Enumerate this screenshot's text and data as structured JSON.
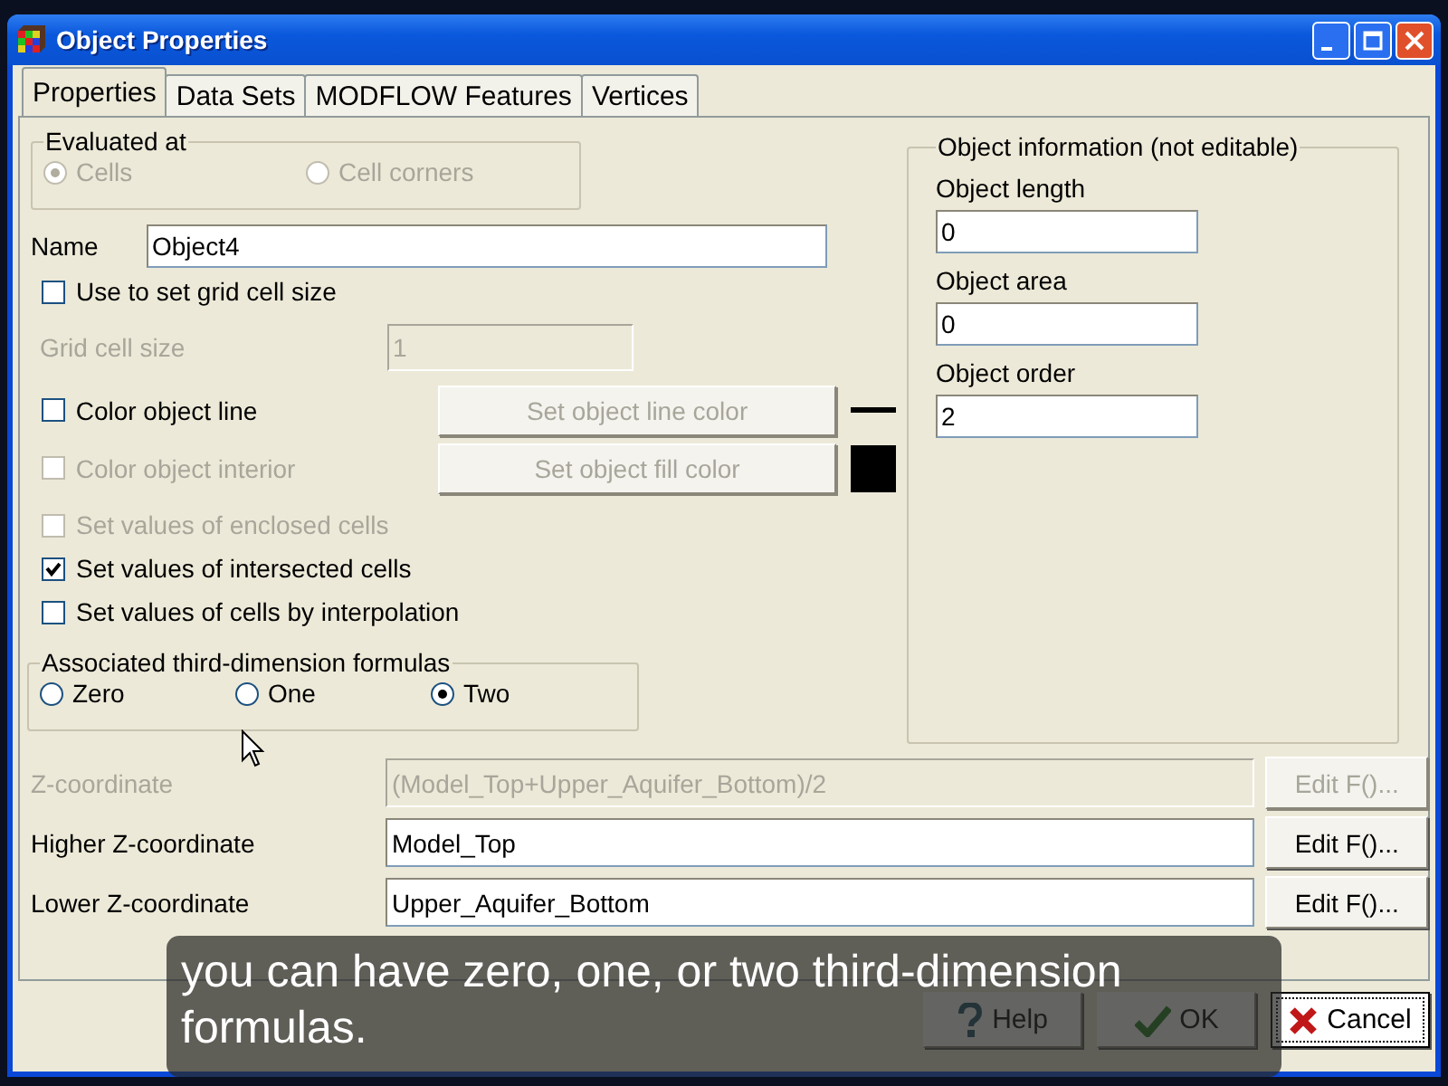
{
  "window": {
    "title": "Object Properties"
  },
  "tabs": [
    {
      "label": "Properties",
      "selected": true
    },
    {
      "label": "Data Sets",
      "selected": false
    },
    {
      "label": "MODFLOW Features",
      "selected": false
    },
    {
      "label": "Vertices",
      "selected": false
    }
  ],
  "evaluated_at": {
    "label": "Evaluated at",
    "disabled": true,
    "options": [
      {
        "label": "Cells",
        "selected": true
      },
      {
        "label": "Cell corners",
        "selected": false
      }
    ]
  },
  "name": {
    "label": "Name",
    "value": "Object4"
  },
  "rows": [
    {
      "kind": "checkbox",
      "label": "Use to set grid cell size",
      "checked": false,
      "disabled": false
    },
    {
      "kind": "field",
      "label": "Grid cell size",
      "value": "1",
      "disabled": true
    },
    {
      "kind": "color",
      "label": "Color object line",
      "checked": false,
      "disabled": false,
      "button": "Set object line color",
      "button_disabled": true,
      "swatch": {
        "kind": "line"
      }
    },
    {
      "kind": "color",
      "label": "Color object interior",
      "checked": false,
      "disabled": true,
      "button": "Set object fill color",
      "button_disabled": true,
      "swatch": {
        "kind": "fill"
      }
    },
    {
      "kind": "checkbox",
      "label": "Set values of enclosed cells",
      "checked": false,
      "disabled": true
    },
    {
      "kind": "checkbox",
      "label": "Set values of intersected cells",
      "checked": true,
      "disabled": false
    },
    {
      "kind": "checkbox",
      "label": "Set values of cells by interpolation",
      "checked": false,
      "disabled": false
    }
  ],
  "formulas": {
    "label": "Associated third-dimension formulas",
    "options": [
      {
        "label": "Zero",
        "selected": false
      },
      {
        "label": "One",
        "selected": false
      },
      {
        "label": "Two",
        "selected": true
      }
    ]
  },
  "object_info": {
    "label": "Object information (not editable)",
    "fields": [
      {
        "label": "Object length",
        "value": "0"
      },
      {
        "label": "Object area",
        "value": "0"
      },
      {
        "label": "Object order",
        "value": "2"
      }
    ]
  },
  "z_rows": [
    {
      "label": "Z-coordinate",
      "value": "(Model_Top+Upper_Aquifer_Bottom)/2",
      "disabled": true,
      "button": "Edit F()..."
    },
    {
      "label": "Higher Z-coordinate",
      "value": "Model_Top",
      "disabled": false,
      "button": "Edit F()..."
    },
    {
      "label": "Lower Z-coordinate",
      "value": "Upper_Aquifer_Bottom",
      "disabled": false,
      "button": "Edit F()..."
    }
  ],
  "buttons": [
    {
      "kind": "help",
      "label": "Help",
      "focused": false
    },
    {
      "kind": "ok",
      "label": "OK",
      "focused": false
    },
    {
      "kind": "cancel",
      "label": "Cancel",
      "focused": true
    }
  ],
  "caption": {
    "text": "you can have zero, one, or two third-dimension formulas."
  }
}
